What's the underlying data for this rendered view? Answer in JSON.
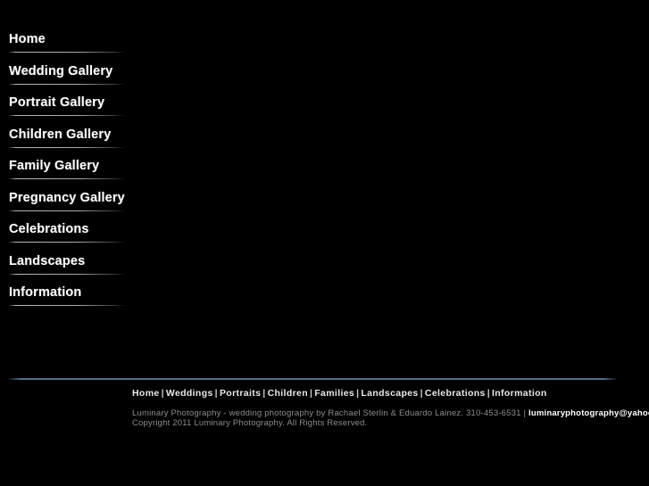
{
  "site": {
    "title": "Luminary Photography",
    "background_color": "#000000",
    "text_color": "#ffffff",
    "divider_color": "#547491",
    "rule_color": "#bebebe"
  },
  "main_nav": {
    "items": [
      {
        "label": "Home"
      },
      {
        "label": "Wedding Gallery"
      },
      {
        "label": "Portrait Gallery"
      },
      {
        "label": "Children Gallery"
      },
      {
        "label": "Family Gallery"
      },
      {
        "label": "Pregnancy Gallery"
      },
      {
        "label": "Celebrations"
      },
      {
        "label": "Landscapes"
      },
      {
        "label": "Information"
      }
    ]
  },
  "footer": {
    "nav": [
      {
        "label": "Home"
      },
      {
        "label": "Weddings"
      },
      {
        "label": "Portraits"
      },
      {
        "label": "Children"
      },
      {
        "label": "Families"
      },
      {
        "label": "Landscapes"
      },
      {
        "label": "Celebrations"
      },
      {
        "label": "Information"
      }
    ],
    "separator": "|",
    "credit_text": "Luminary Photography - wedding photography by Rachael Sterlin & Eduardo Lainez. 310-453-6531",
    "credit_separator": "|",
    "email": "luminaryphotography@yahoo.com",
    "copyright": "Copyright 2011 Luminary Photography. All Rights Reserved."
  }
}
